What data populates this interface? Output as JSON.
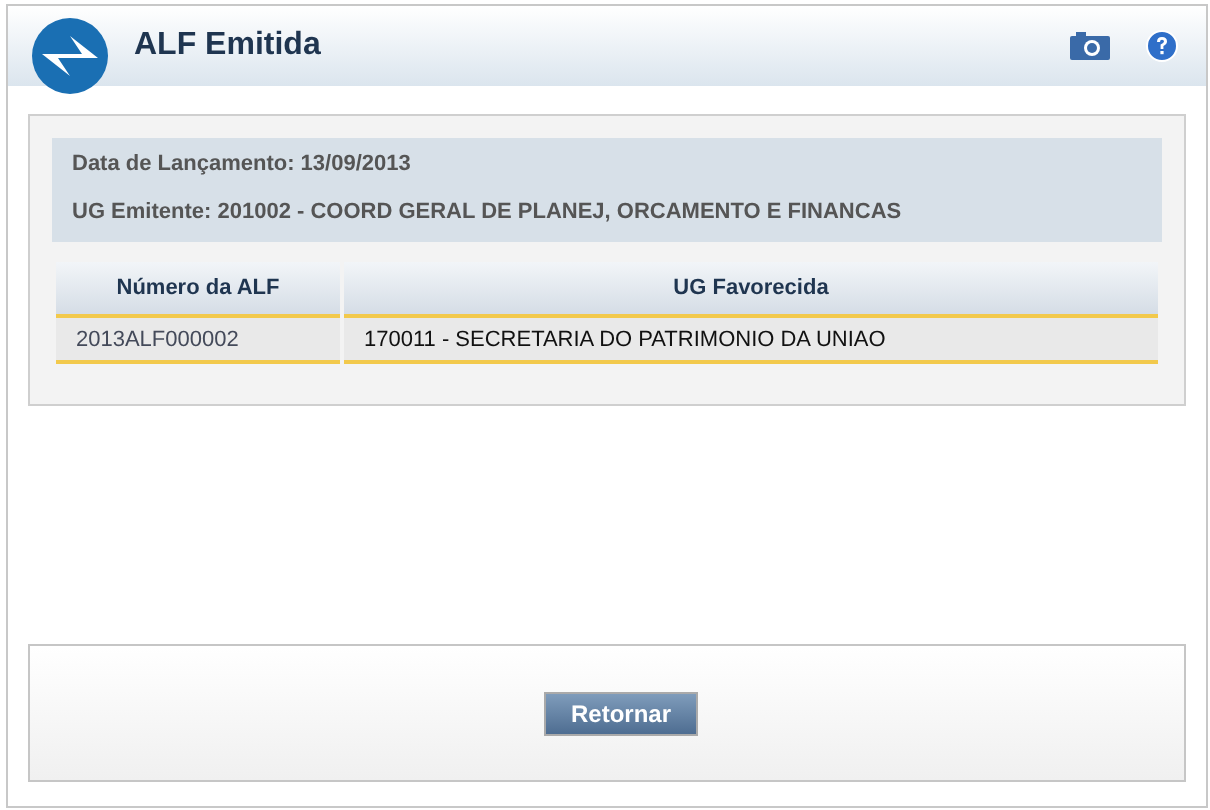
{
  "window": {
    "title": "ALF Emitida"
  },
  "info": [
    "Data de Lançamento: 13/09/2013",
    "UG Emitente: 201002 - COORD GERAL DE PLANEJ, ORCAMENTO E FINANCAS"
  ],
  "table": {
    "columns": [
      "Número da ALF",
      "UG Favorecida"
    ],
    "rows": [
      [
        "2013ALF000002",
        "170011 - SECRETARIA DO PATRIMONIO DA UNIAO"
      ]
    ]
  },
  "buttons": [
    "Retornar"
  ]
}
